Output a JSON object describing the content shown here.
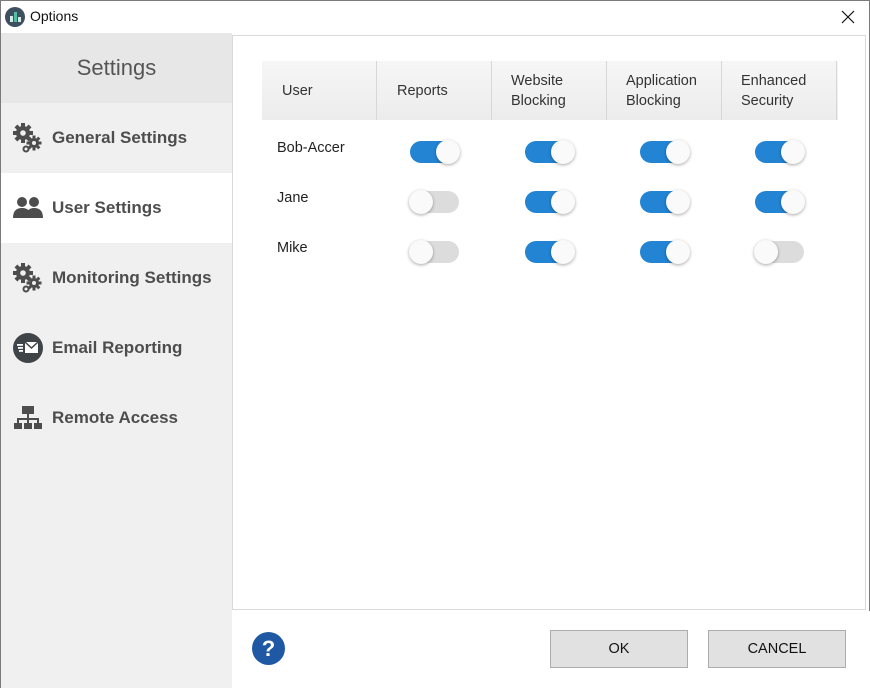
{
  "window": {
    "title": "Options",
    "app_icon": "bar-chart-app-icon",
    "close_icon": "close-icon"
  },
  "sidebar": {
    "header": "Settings",
    "items": [
      {
        "label": "General Settings",
        "icon": "gears-icon",
        "active": false
      },
      {
        "label": "User Settings",
        "icon": "users-icon",
        "active": true
      },
      {
        "label": "Monitoring Settings",
        "icon": "gears-icon",
        "active": false
      },
      {
        "label": "Email Reporting",
        "icon": "email-icon",
        "active": false
      },
      {
        "label": "Remote Access",
        "icon": "network-icon",
        "active": false
      }
    ]
  },
  "table": {
    "headers": [
      "User",
      "Reports",
      "Website Blocking",
      "Application Blocking",
      "Enhanced Security"
    ],
    "header_lines": [
      [
        "User"
      ],
      [
        "Reports"
      ],
      [
        "Website",
        "Blocking"
      ],
      [
        "Application",
        "Blocking"
      ],
      [
        "Enhanced",
        "Security"
      ]
    ],
    "rows": [
      {
        "user": "Bob-Accer",
        "reports": true,
        "website_blocking": true,
        "application_blocking": true,
        "enhanced_security": true
      },
      {
        "user": "Jane",
        "reports": false,
        "website_blocking": true,
        "application_blocking": true,
        "enhanced_security": true
      },
      {
        "user": "Mike",
        "reports": false,
        "website_blocking": true,
        "application_blocking": true,
        "enhanced_security": false
      }
    ]
  },
  "footer": {
    "help_label": "?",
    "ok_label": "OK",
    "cancel_label": "CANCEL"
  },
  "colors": {
    "toggle_on": "#2384d4",
    "toggle_off": "#dcdcdc",
    "help": "#1f59a3"
  }
}
